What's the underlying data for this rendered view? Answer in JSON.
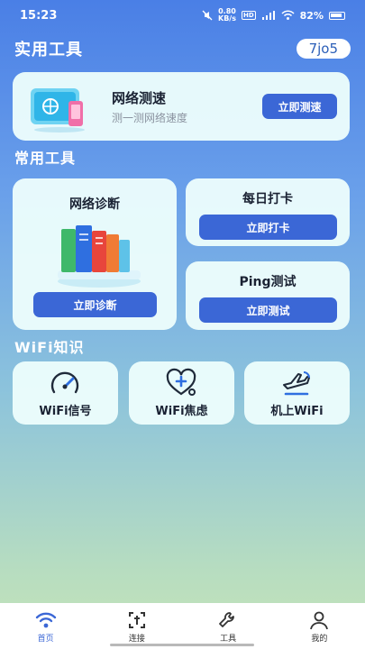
{
  "status_bar": {
    "time": "15:23",
    "net_speed": "0.80",
    "net_unit": "KB/s",
    "hd": "HD",
    "battery": "82%"
  },
  "header": {
    "title": "实用工具",
    "code": "7jo5"
  },
  "speed_test": {
    "title": "网络测速",
    "subtitle": "测一测网络速度",
    "button": "立即测速"
  },
  "common_tools": {
    "title": "常用工具",
    "diagnosis": {
      "title": "网络诊断",
      "button": "立即诊断"
    },
    "checkin": {
      "title": "每日打卡",
      "button": "立即打卡"
    },
    "ping": {
      "title": "Ping测试",
      "button": "立即测试"
    }
  },
  "wifi_knowledge": {
    "title": "WiFi知识",
    "items": [
      {
        "label": "WiFi信号",
        "icon": "signal-gauge-icon"
      },
      {
        "label": "WiFi焦虑",
        "icon": "heart-stethoscope-icon"
      },
      {
        "label": "机上WiFi",
        "icon": "airplane-icon"
      }
    ]
  },
  "tabbar": {
    "items": [
      {
        "label": "首页",
        "icon": "wifi-icon",
        "active": true
      },
      {
        "label": "连接",
        "icon": "connect-scan-icon",
        "active": false
      },
      {
        "label": "工具",
        "icon": "wrench-icon",
        "active": false
      },
      {
        "label": "我的",
        "icon": "person-icon",
        "active": false
      }
    ]
  },
  "colors": {
    "accent": "#3b67d6",
    "card_bg": "#ecfdfc"
  }
}
